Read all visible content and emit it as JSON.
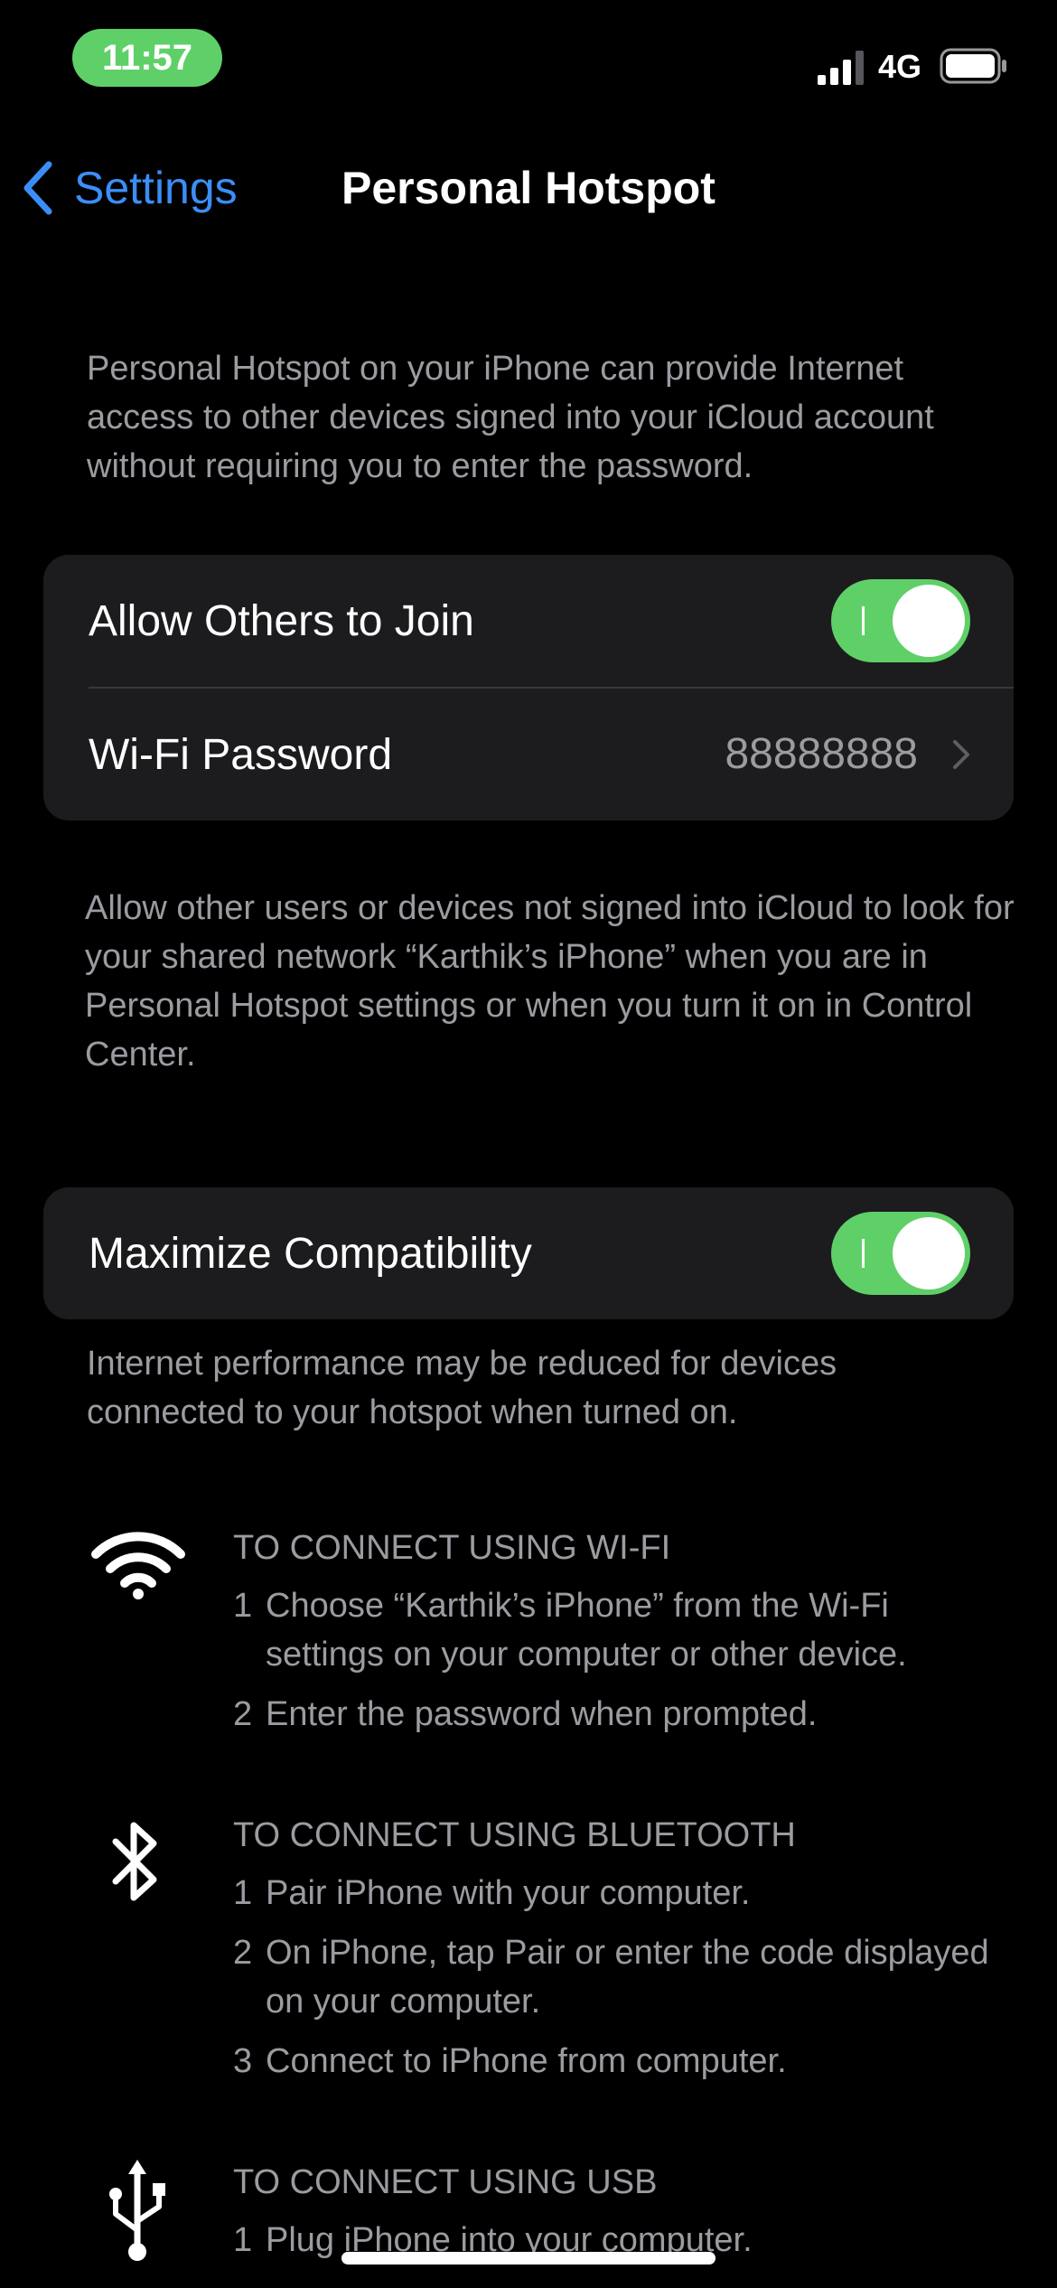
{
  "status_bar": {
    "time": "11:57",
    "network": "4G",
    "accent_color": "#5fd068"
  },
  "nav": {
    "back_label": "Settings",
    "title": "Personal Hotspot",
    "link_color": "#3b8ef7"
  },
  "intro_note": "Personal Hotspot on your iPhone can provide Internet access to other devices signed into your iCloud account without requiring you to enter the password.",
  "hotspot_group": {
    "allow_others_label": "Allow Others to Join",
    "allow_others_on": true,
    "wifi_password_label": "Wi-Fi Password",
    "wifi_password_value": "88888888"
  },
  "allow_note": "Allow other users or devices not signed into iCloud to look for your shared network “Karthik’s iPhone” when you are in Personal Hotspot settings or when you turn it on in Control Center.",
  "compat_group": {
    "maximize_label": "Maximize Compatibility",
    "maximize_on": true
  },
  "compat_note": "Internet performance may be reduced for devices connected to your hotspot when turned on.",
  "connect_sections": [
    {
      "icon": "wifi-icon",
      "title": "TO CONNECT USING WI-FI",
      "steps": [
        {
          "num": "1",
          "text": "Choose “Karthik’s iPhone” from the Wi-Fi settings on your computer or other device."
        },
        {
          "num": "2",
          "text": "Enter the password when prompted."
        }
      ]
    },
    {
      "icon": "bluetooth-icon",
      "title": "TO CONNECT USING BLUETOOTH",
      "steps": [
        {
          "num": "1",
          "text": "Pair iPhone with your computer."
        },
        {
          "num": "2",
          "text": "On iPhone, tap Pair or enter the code displayed on your computer."
        },
        {
          "num": "3",
          "text": "Connect to iPhone from computer."
        }
      ]
    },
    {
      "icon": "usb-icon",
      "title": "TO CONNECT USING USB",
      "steps": [
        {
          "num": "1",
          "text": "Plug iPhone into your computer."
        }
      ]
    }
  ]
}
